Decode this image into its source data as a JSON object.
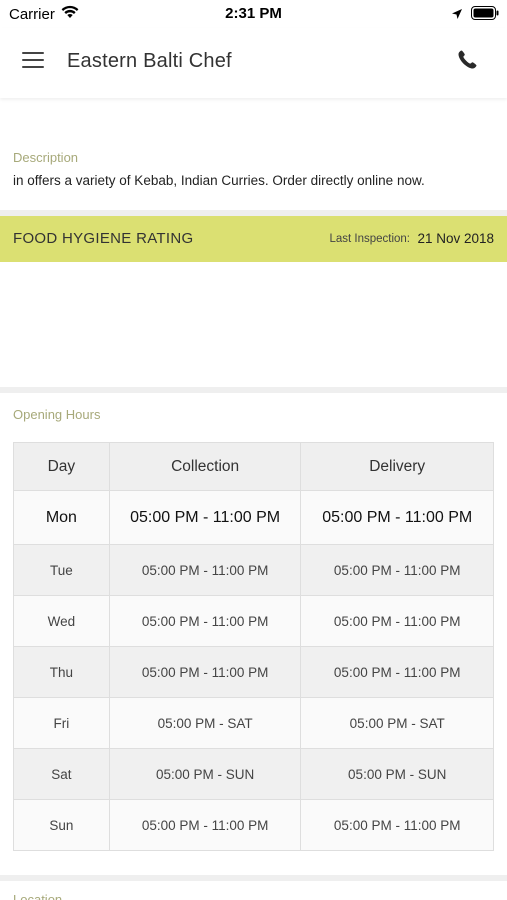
{
  "status": {
    "carrier": "Carrier",
    "time": "2:31 PM"
  },
  "header": {
    "title": "Eastern Balti Chef",
    "menu_icon": "hamburger-menu-icon",
    "phone_icon": "phone-icon"
  },
  "description": {
    "label": "Description",
    "text": "in  offers a variety of Kebab, Indian Curries. Order directly online now."
  },
  "hygiene": {
    "title": "FOOD HYGIENE RATING",
    "inspection_label": "Last Inspection:",
    "inspection_date": "21 Nov 2018"
  },
  "opening_hours": {
    "label": "Opening Hours",
    "headers": {
      "day": "Day",
      "collection": "Collection",
      "delivery": "Delivery"
    },
    "rows": [
      {
        "day": "Mon",
        "collection": "05:00 PM - 11:00 PM",
        "delivery": "05:00 PM - 11:00 PM"
      },
      {
        "day": "Tue",
        "collection": "05:00 PM - 11:00 PM",
        "delivery": "05:00 PM - 11:00 PM"
      },
      {
        "day": "Wed",
        "collection": "05:00 PM - 11:00 PM",
        "delivery": "05:00 PM - 11:00 PM"
      },
      {
        "day": "Thu",
        "collection": "05:00 PM - 11:00 PM",
        "delivery": "05:00 PM - 11:00 PM"
      },
      {
        "day": "Fri",
        "collection": "05:00 PM - SAT",
        "delivery": "05:00 PM - SAT"
      },
      {
        "day": "Sat",
        "collection": "05:00 PM - SUN",
        "delivery": "05:00 PM - SUN"
      },
      {
        "day": "Sun",
        "collection": "05:00 PM - 11:00 PM",
        "delivery": "05:00 PM - 11:00 PM"
      }
    ]
  },
  "location": {
    "label": "Location"
  },
  "colors": {
    "accent_label": "#a7a97a",
    "hygiene_bar": "#dbe072"
  }
}
